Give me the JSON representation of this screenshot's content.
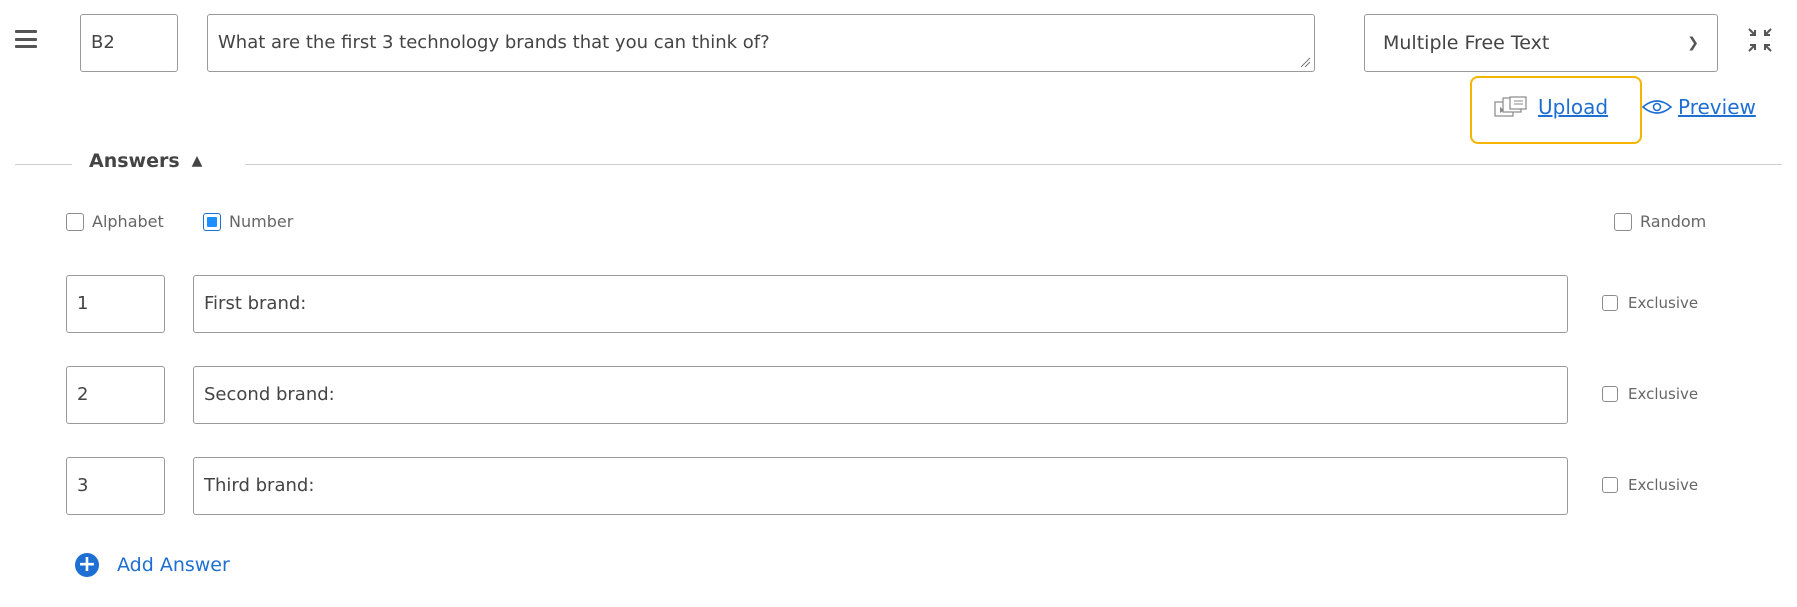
{
  "question": {
    "id": "B2",
    "text": "What are the first 3 technology brands that you can think of?",
    "type": "Multiple Free Text"
  },
  "actions": {
    "upload_label": "Upload",
    "preview_label": "Preview"
  },
  "answers_section": {
    "title": "Answers",
    "options": {
      "alphabet_label": "Alphabet",
      "alphabet_checked": false,
      "number_label": "Number",
      "number_checked": true,
      "random_label": "Random",
      "random_checked": false
    },
    "items": [
      {
        "code": "1",
        "text": "First brand:",
        "exclusive_label": "Exclusive"
      },
      {
        "code": "2",
        "text": "Second brand:",
        "exclusive_label": "Exclusive"
      },
      {
        "code": "3",
        "text": "Third brand:",
        "exclusive_label": "Exclusive"
      }
    ],
    "add_label": "Add Answer"
  },
  "colors": {
    "link_blue": "#1e6fd2",
    "highlight_border": "#f5b400",
    "checkbox_fill": "#1e8fff"
  }
}
